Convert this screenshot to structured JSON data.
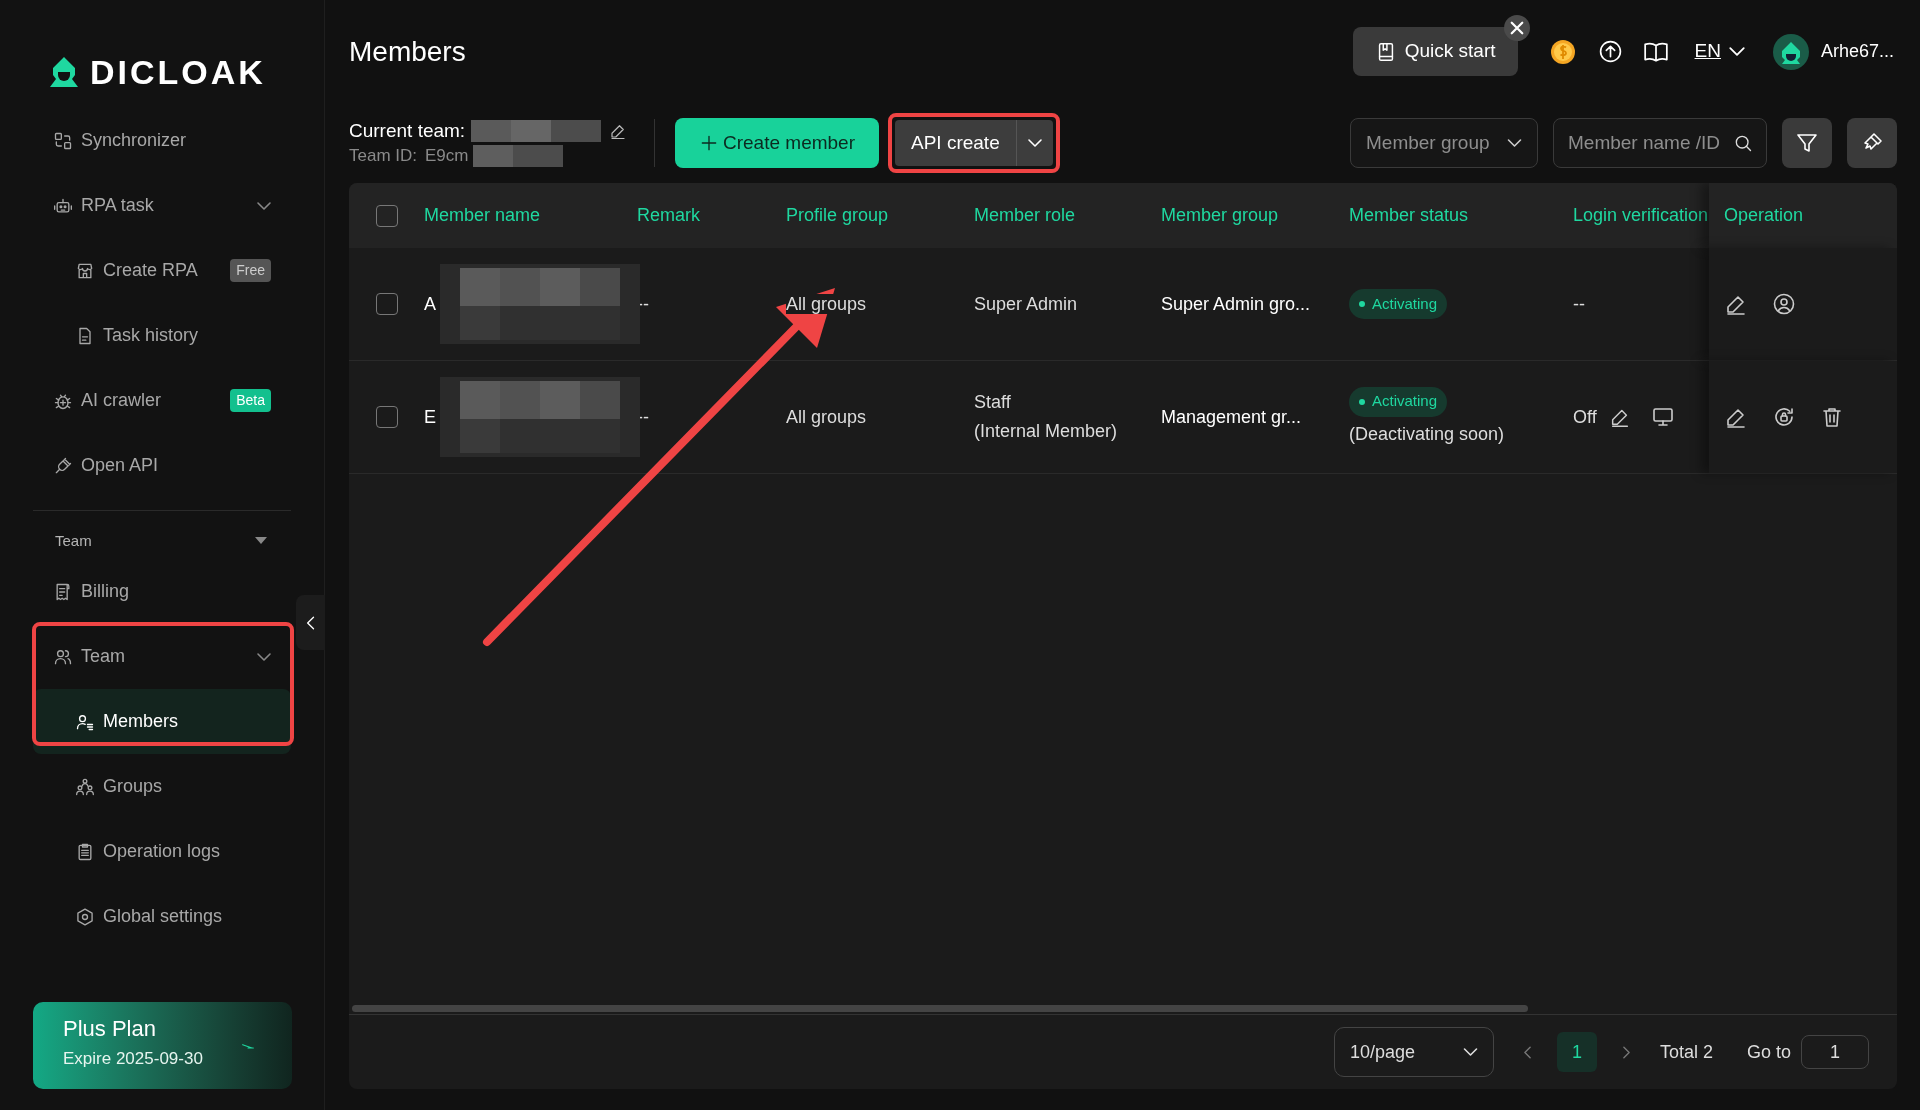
{
  "logo": {
    "text": "DICLOAK"
  },
  "sidebar": {
    "items": [
      {
        "label": "Synchronizer",
        "selected": false
      },
      {
        "label": "RPA task",
        "selected": false,
        "expanded": true,
        "children": [
          {
            "label": "Create RPA",
            "selected": false,
            "badge": {
              "text": "Free",
              "kind": "muted"
            }
          },
          {
            "label": "Task history",
            "selected": false
          }
        ]
      },
      {
        "label": "AI crawler",
        "selected": false,
        "badge": {
          "text": "Beta",
          "kind": "accent"
        }
      },
      {
        "label": "Open API",
        "selected": false
      }
    ],
    "section": {
      "label": "Team",
      "expanded": true
    },
    "section_items": [
      {
        "label": "Billing",
        "selected": false
      },
      {
        "label": "Team",
        "selected": false,
        "expanded": true,
        "children": [
          {
            "label": "Members",
            "selected": true
          },
          {
            "label": "Groups",
            "selected": false
          },
          {
            "label": "Operation logs",
            "selected": false
          },
          {
            "label": "Global settings",
            "selected": false
          }
        ]
      }
    ],
    "plan": {
      "title": "Plus Plan",
      "expiry": "Expire 2025-09-30"
    }
  },
  "header": {
    "title": "Members",
    "quick_start": "Quick start",
    "language": "EN",
    "user": "Arhe67..."
  },
  "toolbar": {
    "current_team_label": "Current team:",
    "team_id_label": "Team ID:",
    "team_id": "E9cm",
    "create_button": "Create member",
    "api_button": "API create",
    "group_select": {
      "placeholder": "Member group"
    },
    "search": {
      "placeholder": "Member name /ID"
    }
  },
  "table": {
    "columns": [
      "Member name",
      "Remark",
      "Profile group",
      "Member role",
      "Member group",
      "Member status",
      "Login verification",
      "Operation"
    ],
    "header_checked": false,
    "rows": [
      {
        "kind": "owner",
        "checked": false,
        "name": "A",
        "remark": "--",
        "profile_group": "All groups",
        "role": [
          "Super Admin"
        ],
        "member_group": "Super Admin gro...",
        "status": "Activating",
        "login_verification": "--"
      },
      {
        "kind": "staff",
        "checked": false,
        "name": "E",
        "remark": "--",
        "profile_group": "All groups",
        "role": [
          "Staff",
          "(Internal Member)"
        ],
        "member_group": "Management gr...",
        "status": "Activating",
        "status_note": "(Deactivating soon)",
        "login_verification": "Off"
      }
    ]
  },
  "pagination": {
    "page_size": "10/page",
    "pages": [
      {
        "label": "1",
        "selected": true
      }
    ],
    "total": "Total 2",
    "goto_label": "Go to",
    "goto_value": "1"
  }
}
